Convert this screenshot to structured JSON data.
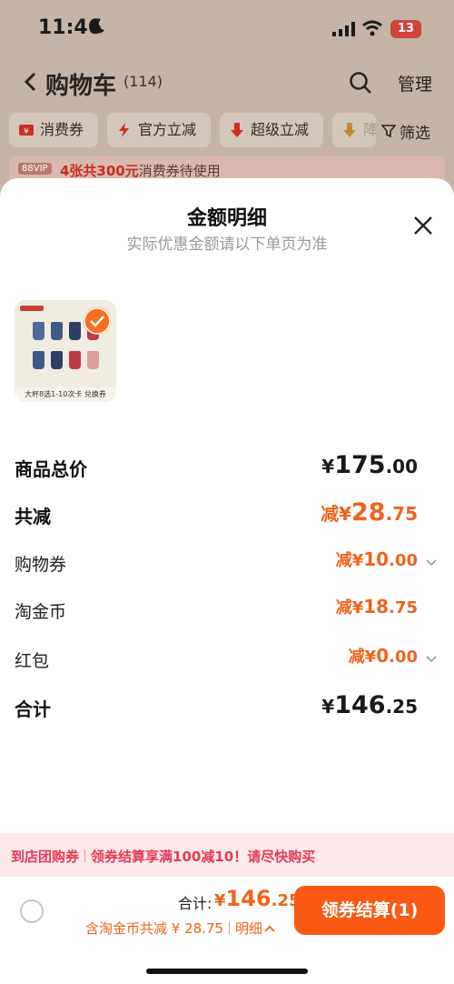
{
  "status_bar": {
    "time": "11:46",
    "battery": "13"
  },
  "nav": {
    "title": "购物车",
    "count": "(114)",
    "manage_label": "管理"
  },
  "filters": [
    {
      "label": "消费券",
      "icon": "coupon-icon"
    },
    {
      "label": "官方立减",
      "icon": "lightning-icon"
    },
    {
      "label": "超级立减",
      "icon": "down-arrow-icon"
    },
    {
      "label": "降",
      "icon": "down-arrow-icon"
    }
  ],
  "filter_button": "筛选",
  "vip": {
    "badge": "88VIP",
    "highlight": "4张共300元",
    "text": "消费券待使用"
  },
  "sheet": {
    "title": "金额明细",
    "subtitle": "实际优惠金额请以下单页为准",
    "product": {
      "caption": "大杯8选1-10次卡 兑换券"
    },
    "rows": {
      "subtotal": {
        "label": "商品总价",
        "cur": "¥",
        "int": "175",
        "dec": ".00"
      },
      "discount": {
        "label": "共减",
        "prefix": "减",
        "cur": "¥",
        "int": "28",
        "dec": ".75"
      },
      "coupon": {
        "label": "购物券",
        "prefix": "减",
        "cur": "¥",
        "int": "10",
        "dec": ".00"
      },
      "coins": {
        "label": "淘金币",
        "prefix": "减",
        "cur": "¥",
        "int": "18",
        "dec": ".75"
      },
      "redpacket": {
        "label": "红包",
        "prefix": "减",
        "cur": "¥",
        "int": "0",
        "dec": ".00"
      },
      "total": {
        "label": "合计",
        "cur": "¥",
        "int": "146",
        "dec": ".25"
      }
    }
  },
  "promo": {
    "left": "到店团购券",
    "right": "领券结算享满100减10！请尽快购买"
  },
  "checkout": {
    "total_label": "合计:",
    "total_cur": "¥",
    "total_int": "146",
    "total_dec": ".25",
    "deduct_text": "含淘金币共减 ¥ 28.75",
    "detail_label": "明细",
    "cta_label": "领券结算(1)"
  },
  "colors": {
    "accent": "#f85a14",
    "price_orange": "#f0641d",
    "promo_pink": "#e53a56"
  }
}
